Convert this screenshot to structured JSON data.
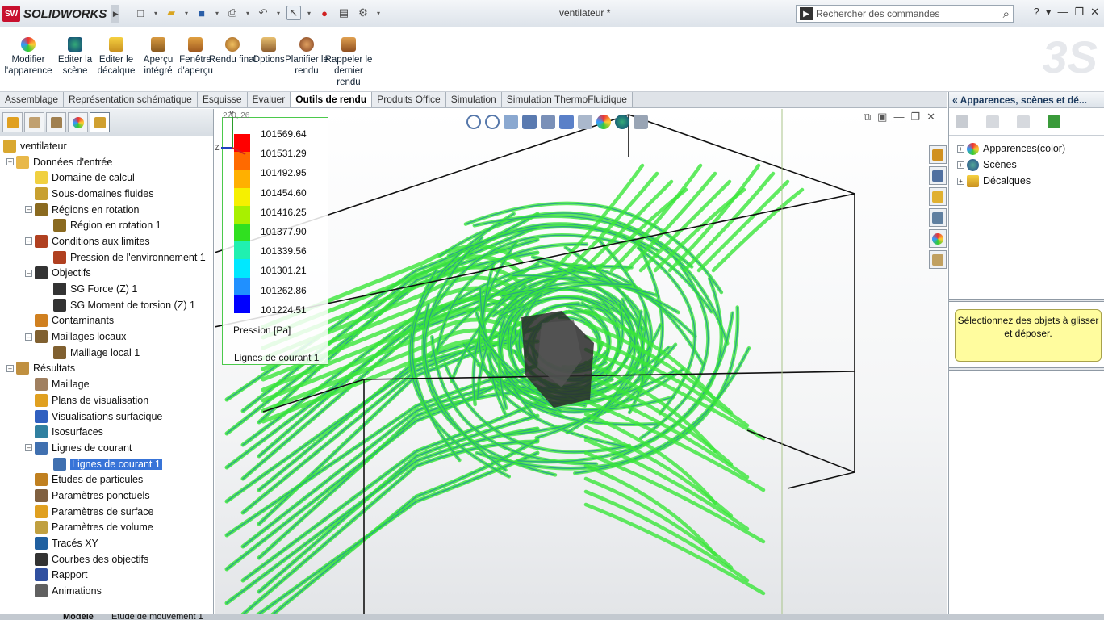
{
  "app": {
    "brand": "SOLIDWORKS",
    "brand_badge": "SW",
    "document_title": "ventilateur *"
  },
  "search": {
    "placeholder": "Rechercher des commandes"
  },
  "ribbon": {
    "buttons": [
      {
        "label": "Modifier l'apparence",
        "icon": "appearance-icon"
      },
      {
        "label": "Editer la scène",
        "icon": "scene-icon"
      },
      {
        "label": "Editer le décalque",
        "icon": "decal-icon"
      },
      {
        "label": "Aperçu intégré",
        "icon": "preview-icon"
      },
      {
        "label": "Fenêtre d'aperçu",
        "icon": "preview-window-icon"
      },
      {
        "label": "Rendu final",
        "icon": "final-render-icon"
      },
      {
        "label": "Options",
        "icon": "options-icon"
      },
      {
        "label": "Planifier le rendu",
        "icon": "schedule-render-icon"
      },
      {
        "label": "Rappeler le dernier rendu",
        "icon": "recall-render-icon"
      }
    ]
  },
  "tabs": [
    {
      "label": "Assemblage",
      "active": false
    },
    {
      "label": "Représentation schématique",
      "active": false
    },
    {
      "label": "Esquisse",
      "active": false
    },
    {
      "label": "Evaluer",
      "active": false
    },
    {
      "label": "Outils de rendu",
      "active": true
    },
    {
      "label": "Produits Office",
      "active": false
    },
    {
      "label": "Simulation",
      "active": false
    },
    {
      "label": "Simulation ThermoFluidique",
      "active": false
    }
  ],
  "tree": {
    "root": "ventilateur",
    "items": [
      {
        "label": "Données d'entrée",
        "level": 1,
        "toggle": "-",
        "color": "#e8b84a"
      },
      {
        "label": "Domaine de calcul",
        "level": 2,
        "color": "#f0d040"
      },
      {
        "label": "Sous-domaines fluides",
        "level": 2,
        "color": "#c8a030"
      },
      {
        "label": "Régions en rotation",
        "level": 2,
        "toggle": "-",
        "color": "#8a6a20"
      },
      {
        "label": "Région en rotation 1",
        "level": 3,
        "color": "#8a6a20"
      },
      {
        "label": "Conditions aux limites",
        "level": 2,
        "toggle": "-",
        "color": "#b04020"
      },
      {
        "label": "Pression de l'environnement 1",
        "level": 3,
        "color": "#b04020"
      },
      {
        "label": "Objectifs",
        "level": 2,
        "toggle": "-",
        "color": "#333333"
      },
      {
        "label": "SG Force (Z) 1",
        "level": 3,
        "color": "#333333"
      },
      {
        "label": "SG Moment de torsion (Z) 1",
        "level": 3,
        "color": "#333333"
      },
      {
        "label": "Contaminants",
        "level": 2,
        "color": "#d08020"
      },
      {
        "label": "Maillages locaux",
        "level": 2,
        "toggle": "-",
        "color": "#806030"
      },
      {
        "label": "Maillage local 1",
        "level": 3,
        "color": "#806030"
      },
      {
        "label": "Résultats",
        "level": 1,
        "toggle": "-",
        "color": "#c09040"
      },
      {
        "label": "Maillage",
        "level": 2,
        "color": "#a08060"
      },
      {
        "label": "Plans de visualisation",
        "level": 2,
        "color": "#e0a020"
      },
      {
        "label": "Visualisations surfacique",
        "level": 2,
        "color": "#3060c0"
      },
      {
        "label": "Isosurfaces",
        "level": 2,
        "color": "#3080a0"
      },
      {
        "label": "Lignes de courant",
        "level": 2,
        "toggle": "-",
        "color": "#4070b0"
      },
      {
        "label": "Lignes de courant 1",
        "level": 3,
        "color": "#4070b0",
        "selected": true
      },
      {
        "label": "Etudes de particules",
        "level": 2,
        "color": "#c08020"
      },
      {
        "label": "Paramètres ponctuels",
        "level": 2,
        "color": "#806040"
      },
      {
        "label": "Paramètres de surface",
        "level": 2,
        "color": "#e0a020"
      },
      {
        "label": "Paramètres de volume",
        "level": 2,
        "color": "#c0a040"
      },
      {
        "label": "Tracés XY",
        "level": 2,
        "color": "#2060a0"
      },
      {
        "label": "Courbes des objectifs",
        "level": 2,
        "color": "#333333"
      },
      {
        "label": "Rapport",
        "level": 2,
        "color": "#3050a0"
      },
      {
        "label": "Animations",
        "level": 2,
        "color": "#606060"
      }
    ]
  },
  "bottom_tabs": [
    {
      "label": "Modèle"
    },
    {
      "label": "Etude de mouvement 1"
    }
  ],
  "legend": {
    "coords": "270, 26",
    "values": [
      "101569.64",
      "101531.29",
      "101492.95",
      "101454.60",
      "101416.25",
      "101377.90",
      "101339.56",
      "101301.21",
      "101262.86",
      "101224.51"
    ],
    "colors": [
      "#ff0000",
      "#ff6a00",
      "#ffb000",
      "#f6f000",
      "#a8f000",
      "#30e020",
      "#20f0b0",
      "#00e8ff",
      "#2090ff",
      "#0000ff"
    ],
    "unit": "Pression [Pa]",
    "caption": "Lignes de courant 1"
  },
  "task_pane": {
    "title": "Apparences, scènes et dé...",
    "items": [
      {
        "label": "Apparences(color)",
        "color": "#e84030"
      },
      {
        "label": "Scènes",
        "color": "#2060c0"
      },
      {
        "label": "Décalques",
        "color": "#e0b020"
      }
    ],
    "hint": "Sélectionnez des objets à glisser et déposer."
  },
  "colors": {
    "streamline_green": "#39e639",
    "streamline_teal": "#2a9d8f",
    "selection": "#3874d8"
  }
}
